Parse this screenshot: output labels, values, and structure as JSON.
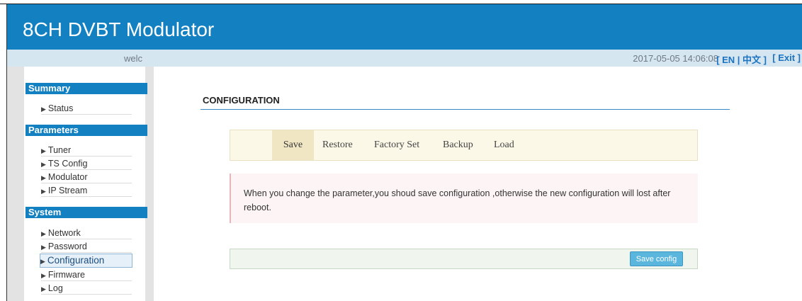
{
  "header": {
    "title": "8CH DVBT Modulator"
  },
  "subbar": {
    "welcome": "welc",
    "datetime": "2017-05-05 14:06:08",
    "lang": "[ EN | 中文 ]",
    "exit": "[ Exit ]"
  },
  "sidebar": {
    "summary": {
      "title": "Summary",
      "items": [
        "Status"
      ]
    },
    "parameters": {
      "title": "Parameters",
      "items": [
        "Tuner",
        "TS Config",
        "Modulator",
        "IP Stream"
      ]
    },
    "system": {
      "title": "System",
      "items": [
        "Network",
        "Password",
        "Configuration",
        "Firmware",
        "Log"
      ]
    }
  },
  "main": {
    "title": "CONFIGURATION",
    "tabs": [
      "Save",
      "Restore",
      "Factory Set",
      "Backup",
      "Load"
    ],
    "message": "When you change the parameter,you shoud save configuration ,otherwise the new configuration will lost after reboot.",
    "save_button": "Save config"
  },
  "colors": {
    "brand": "#1381c1",
    "subbar": "#d6e6f1",
    "button": "#5ab6dd"
  }
}
